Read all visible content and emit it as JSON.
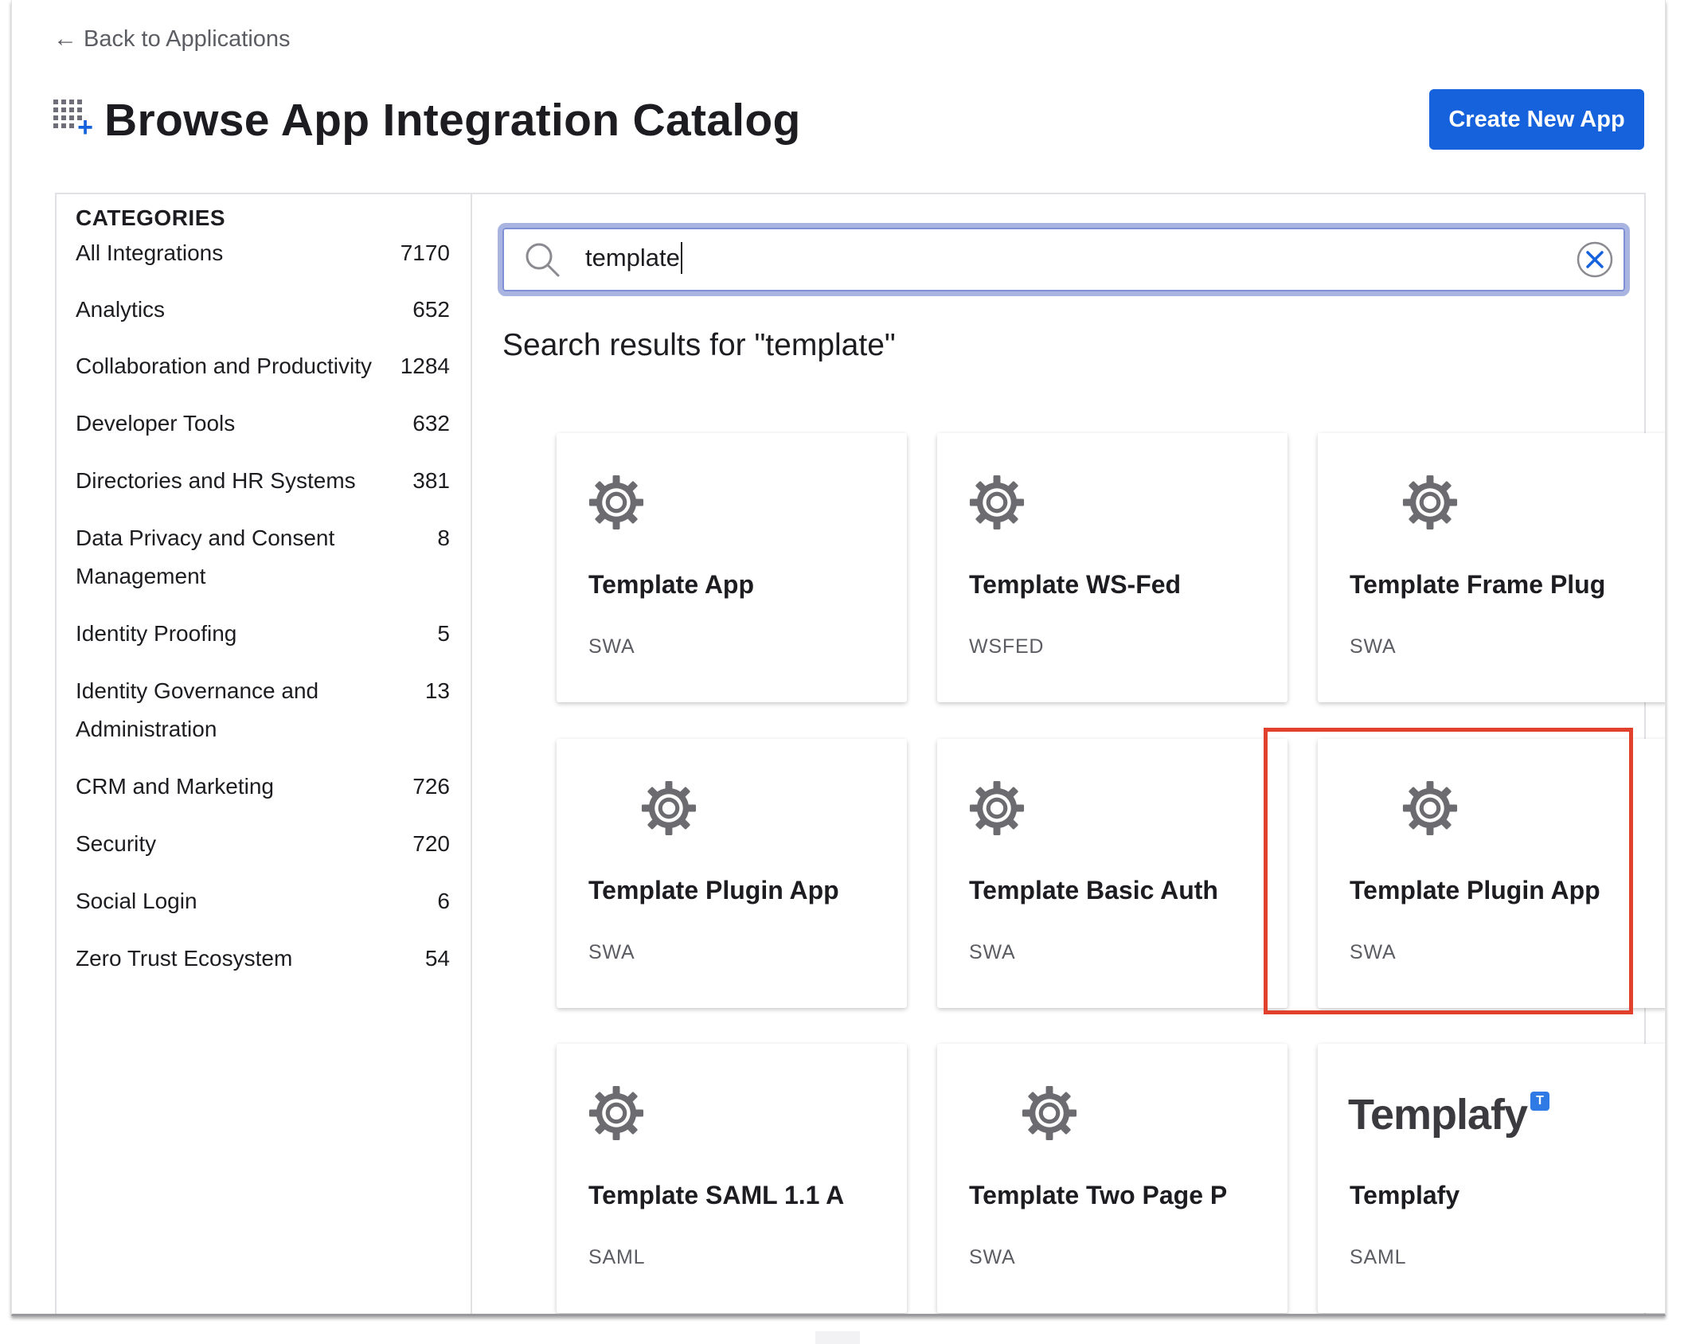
{
  "nav": {
    "back_arrow": "←",
    "back_label": "Back to Applications"
  },
  "header": {
    "title": "Browse App Integration Catalog",
    "create_button": "Create New App",
    "title_icon": "add-integration-icon"
  },
  "categories": {
    "heading": "CATEGORIES",
    "items": [
      {
        "label": "All Integrations",
        "count": "7170"
      },
      {
        "label": "Analytics",
        "count": "652"
      },
      {
        "label": "Collaboration and Productivity",
        "count": "1284"
      },
      {
        "label": "Developer Tools",
        "count": "632"
      },
      {
        "label": "Directories and HR Systems",
        "count": "381"
      },
      {
        "label": "Data Privacy and Consent Management",
        "count": "8"
      },
      {
        "label": "Identity Proofing",
        "count": "5"
      },
      {
        "label": "Identity Governance and Administration",
        "count": "13"
      },
      {
        "label": "CRM and Marketing",
        "count": "726"
      },
      {
        "label": "Security",
        "count": "720"
      },
      {
        "label": "Social Login",
        "count": "6"
      },
      {
        "label": "Zero Trust Ecosystem",
        "count": "54"
      }
    ]
  },
  "search": {
    "value": "template",
    "results_title": "Search results for \"template\""
  },
  "results": [
    {
      "name": "Template App",
      "protocol": "SWA",
      "logo": "gear-icon"
    },
    {
      "name": "Template WS-Fed",
      "protocol": "WSFED",
      "logo": "gear-icon"
    },
    {
      "name": "Template Frame Plug",
      "protocol": "SWA",
      "logo": "gear-icon"
    },
    {
      "name": "Template Plugin App",
      "protocol": "SWA",
      "logo": "gear-icon"
    },
    {
      "name": "Template Basic Auth",
      "protocol": "SWA",
      "logo": "gear-icon"
    },
    {
      "name": "Template Plugin App",
      "protocol": "SWA",
      "logo": "gear-icon",
      "highlighted": true
    },
    {
      "name": "Template SAML 1.1 A",
      "protocol": "SAML",
      "logo": "gear-icon"
    },
    {
      "name": "Template Two Page P",
      "protocol": "SWA",
      "logo": "gear-icon"
    },
    {
      "name": "Templafy",
      "protocol": "SAML",
      "logo": "templafy-logo",
      "logo_text": "Templafy"
    }
  ],
  "colors": {
    "primary": "#1662dd",
    "highlight": "#e1402c",
    "search_border": "#aab4e0",
    "gear": "#6b6b70"
  }
}
